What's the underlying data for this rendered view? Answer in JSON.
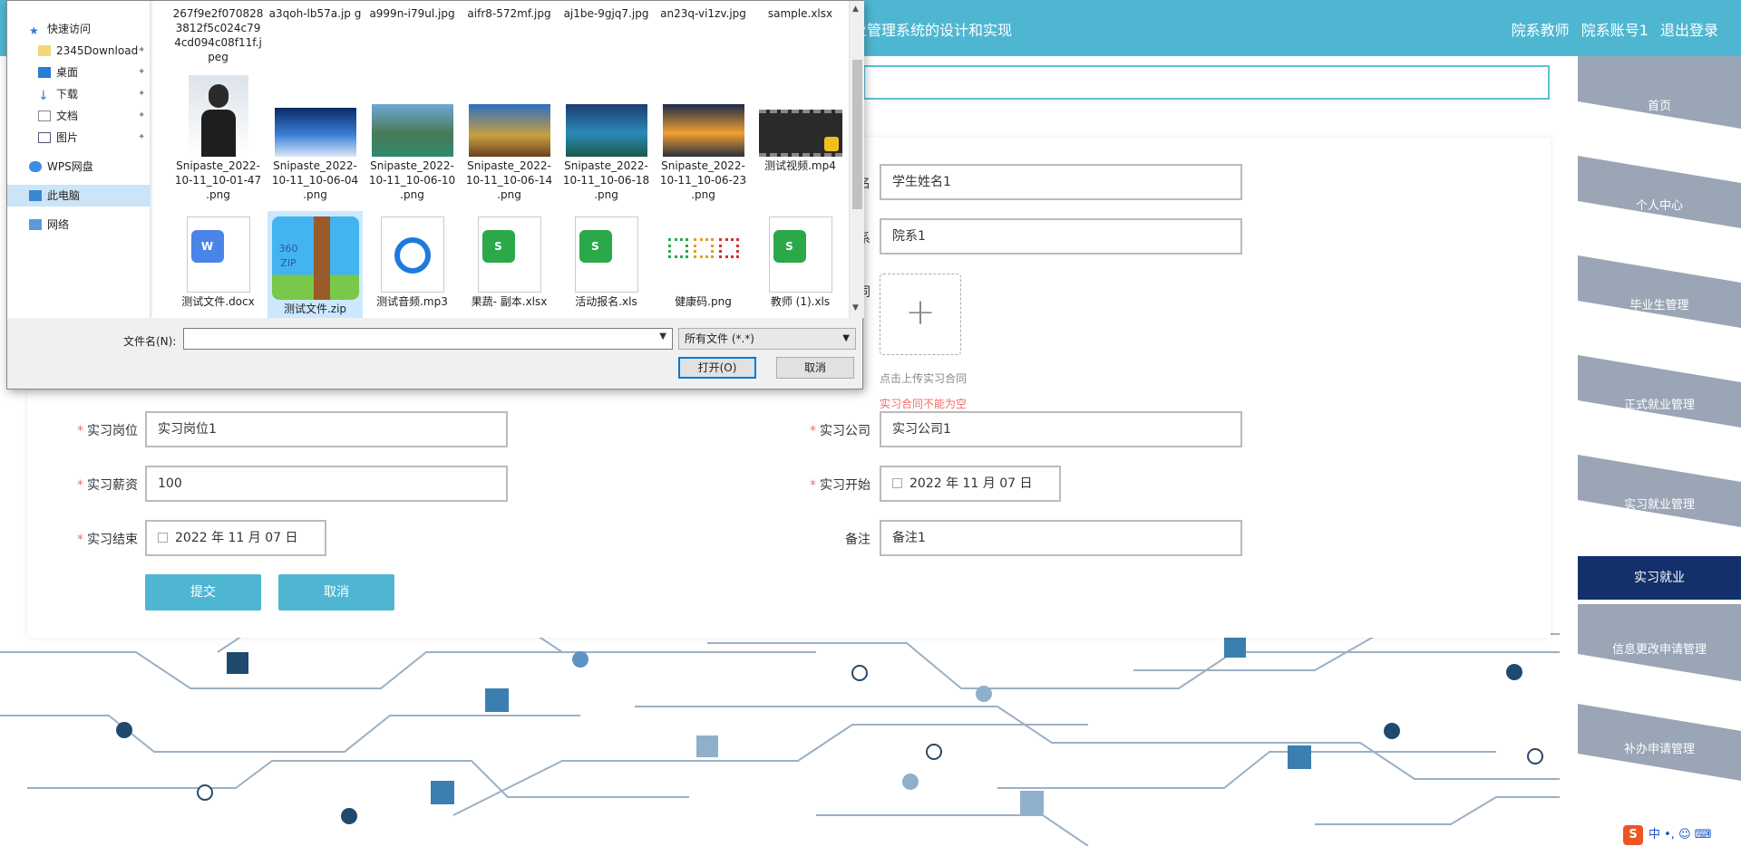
{
  "header": {
    "title_fragment": "业管理系统的设计和实现",
    "user_role": "院系教师",
    "user_name": "院系账号1",
    "logout": "退出登录"
  },
  "sidebar": {
    "items": [
      {
        "label": "首页",
        "icon": "home-icon"
      },
      {
        "label": "个人中心",
        "icon": "user-icon"
      },
      {
        "label": "毕业生管理",
        "icon": "grid-icon"
      },
      {
        "label": "正式就业管理",
        "icon": "monitor-icon"
      },
      {
        "label": "实习就业管理",
        "icon": "monitor-icon"
      },
      {
        "label": "信息更改申请管理",
        "icon": "grid-icon"
      },
      {
        "label": "补办申请管理",
        "icon": "grid-icon"
      }
    ],
    "active": "实习就业"
  },
  "form": {
    "student_name_label_tail": "名",
    "student_name": "学生姓名1",
    "department_label_tail": "系",
    "department": "院系1",
    "contract_label_tail": "同",
    "upload_hint": "点击上传实习合同",
    "upload_error": "实习合同不能为空",
    "position_label": "实习岗位",
    "position": "实习岗位1",
    "company_label": "实习公司",
    "company": "实习公司1",
    "salary_label": "实习薪资",
    "salary": "100",
    "start_label": "实习开始",
    "start_date": "2022 年 11 月 07 日",
    "end_label": "实习结束",
    "end_date": "2022 年 11 月 07 日",
    "remark_label": "备注",
    "remark": "备注1",
    "submit": "提交",
    "cancel": "取消"
  },
  "dialog": {
    "nav": [
      {
        "label": "快速访问",
        "icon": "star-icon"
      },
      {
        "label": "2345Download",
        "icon": "folder-icon"
      },
      {
        "label": "桌面",
        "icon": "desktop-icon"
      },
      {
        "label": "下载",
        "icon": "download-icon"
      },
      {
        "label": "文档",
        "icon": "document-icon"
      },
      {
        "label": "图片",
        "icon": "picture-icon"
      },
      {
        "label": "WPS网盘",
        "icon": "cloud-icon"
      },
      {
        "label": "此电脑",
        "icon": "computer-icon"
      },
      {
        "label": "网络",
        "icon": "network-icon"
      }
    ],
    "row1": [
      "267f9e2f070828 3812f5c024c79 4cd094c08f11f.j peg",
      "a3qoh-lb57a.jp g",
      "a999n-i79ul.jpg",
      "aifr8-572mf.jpg",
      "aj1be-9gjq7.jpg",
      "an23q-vi1zv.jpg",
      "sample.xlsx"
    ],
    "row2": [
      "Snipaste_2022- 10-11_10-01-47 .png",
      "Snipaste_2022- 10-11_10-06-04 .png",
      "Snipaste_2022- 10-11_10-06-10 .png",
      "Snipaste_2022- 10-11_10-06-14 .png",
      "Snipaste_2022- 10-11_10-06-18 .png",
      "Snipaste_2022- 10-11_10-06-23 .png",
      "测试视频.mp4"
    ],
    "row3": [
      "测试文件.docx",
      "测试文件.zip",
      "测试音频.mp3",
      "果蔬- 副本.xlsx",
      "活动报名.xls",
      "健康码.png",
      "教师 (1).xls"
    ],
    "filename_label": "文件名(N):",
    "filename_value": "",
    "filetype": "所有文件 (*.*)",
    "open": "打开(O)",
    "cancel": "取消"
  },
  "ime": {
    "label": "中 •, ☺ ⌨"
  }
}
